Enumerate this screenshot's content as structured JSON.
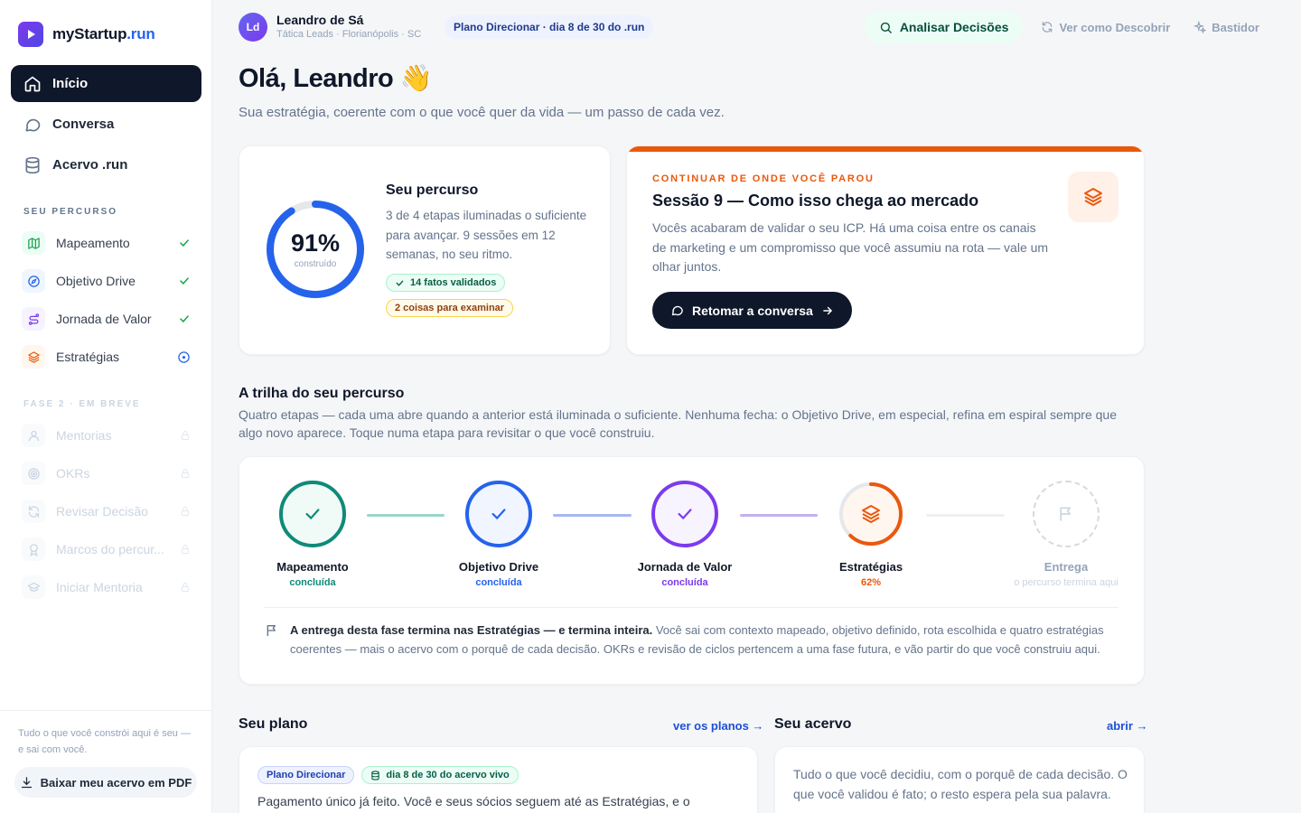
{
  "brand": {
    "name": "myStartup",
    "suffix": ".run"
  },
  "nav": [
    {
      "label": "Início",
      "icon": "home-icon",
      "active": true
    },
    {
      "label": "Conversa",
      "icon": "chat-icon",
      "active": false
    },
    {
      "label": "Acervo .run",
      "icon": "database-icon",
      "active": false
    }
  ],
  "sidebar": {
    "percurso_label": "SEU PERCURSO",
    "percurso_items": [
      {
        "label": "Mapeamento",
        "icon": "map-icon",
        "status": "done",
        "color": "#16a34a"
      },
      {
        "label": "Objetivo Drive",
        "icon": "compass-icon",
        "status": "done",
        "color": "#2563eb"
      },
      {
        "label": "Jornada de Valor",
        "icon": "route-icon",
        "status": "done",
        "color": "#7c3aed"
      },
      {
        "label": "Estratégias",
        "icon": "layers-icon",
        "status": "in-progress",
        "color": "#ea580c"
      }
    ],
    "fase2_label": "FASE 2 · EM BREVE",
    "fase2_items": [
      {
        "label": "Mentorias",
        "icon": "users-icon"
      },
      {
        "label": "OKRs",
        "icon": "target-icon"
      },
      {
        "label": "Revisar Decisão",
        "icon": "refresh-icon"
      },
      {
        "label": "Marcos do percur...",
        "icon": "award-icon"
      },
      {
        "label": "Iniciar Mentoria",
        "icon": "graduation-icon"
      }
    ],
    "footer_text": "Tudo o que você constrói aqui é seu — e sai com você.",
    "pdf_button": "Baixar meu acervo em PDF"
  },
  "user": {
    "initials": "Ld",
    "name": "Leandro de Sá",
    "subtitle": "Tática Leads · Florianópolis · SC",
    "plan_badge": "Plano Direcionar · dia 8 de 30 do .run"
  },
  "top_actions": {
    "analisar": "Analisar Decisões",
    "ver_como": "Ver como Descobrir",
    "bastidor": "Bastidor"
  },
  "greeting": {
    "title": "Olá, Leandro 👋",
    "subtitle": "Sua estratégia, coerente com o que você quer da vida — um passo de cada vez."
  },
  "progress_card": {
    "percent": 91,
    "percent_label": "91%",
    "percent_sub": "construído",
    "title": "Seu percurso",
    "description": "3 de 4 etapas iluminadas o suficiente para avançar. 9 sessões em 12 semanas, no seu ritmo.",
    "badge_facts": "14 fatos validados",
    "badge_examine": "2 coisas para examinar",
    "ring_color": "#2563eb"
  },
  "continue_card": {
    "kicker": "CONTINUAR DE ONDE VOCÊ PAROU",
    "title": "Sessão 9 — Como isso chega ao mercado",
    "description": "Vocês acabaram de validar o seu ICP. Há uma coisa entre os canais de marketing e um compromisso que você assumiu na rota — vale um olhar juntos.",
    "button": "Retomar a conversa",
    "accent": "#ea580c"
  },
  "trail": {
    "title": "A trilha do seu percurso",
    "description": "Quatro etapas — cada uma abre quando a anterior está iluminada o suficiente. Nenhuma fecha: o Objetivo Drive, em especial, refina em espiral sempre que algo novo aparece. Toque numa etapa para revisitar o que você construiu.",
    "nodes": [
      {
        "name": "Mapeamento",
        "status": "concluída",
        "color": "#0f8a78",
        "progress": 1
      },
      {
        "name": "Objetivo Drive",
        "status": "concluída",
        "color": "#2563eb",
        "progress": 1
      },
      {
        "name": "Jornada de Valor",
        "status": "concluída",
        "color": "#7c3aed",
        "progress": 1
      },
      {
        "name": "Estratégias",
        "status": "62%",
        "color": "#ea580c",
        "progress": 0.62
      },
      {
        "name": "Entrega",
        "status": "o percurso termina aqui",
        "color": "#cbd5e1",
        "progress": 0
      }
    ],
    "note_bold": "A entrega desta fase termina nas Estratégias — e termina inteira.",
    "note_rest": " Você sai com contexto mapeado, objetivo definido, rota escolhida e quatro estratégias coerentes — mais o acervo com o porquê de cada decisão. OKRs e revisão de ciclos pertencem a uma fase futura, e vão partir do que você construiu aqui."
  },
  "plan_section": {
    "title": "Seu plano",
    "link": "ver os planos →",
    "badge_plan": "Plano Direcionar",
    "badge_day": "dia 8 de 30 do acervo vivo",
    "text": "Pagamento único já feito. Você e seus sócios seguem até as Estratégias, e o"
  },
  "acervo_section": {
    "title": "Seu acervo",
    "link": "abrir →",
    "text": "Tudo o que você decidiu, com o porquê de cada decisão. O que você validou é fato; o resto espera pela sua palavra."
  }
}
